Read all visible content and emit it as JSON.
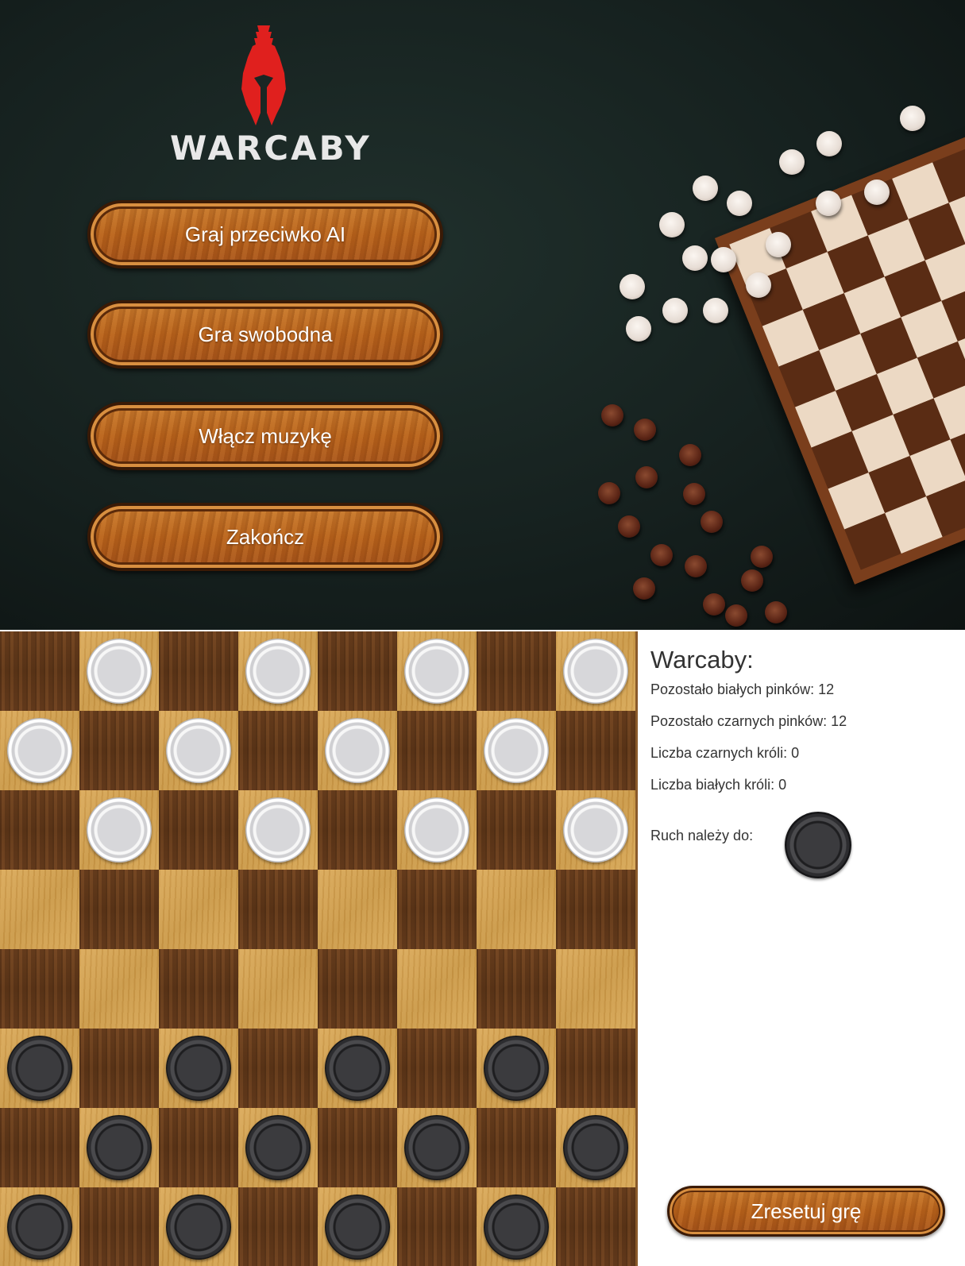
{
  "menu": {
    "logo_text": "WARCABY",
    "buttons": [
      {
        "label": "Graj przeciwko AI"
      },
      {
        "label": "Gra swobodna"
      },
      {
        "label": "Włącz muzykę"
      },
      {
        "label": "Zakończ"
      }
    ]
  },
  "board": {
    "rows": [
      [
        "",
        "w",
        "",
        "w",
        "",
        "w",
        "",
        "w"
      ],
      [
        "w",
        "",
        "w",
        "",
        "w",
        "",
        "w",
        ""
      ],
      [
        "",
        "w",
        "",
        "w",
        "",
        "w",
        "",
        "w"
      ],
      [
        "",
        "",
        "",
        "",
        "",
        "",
        "",
        ""
      ],
      [
        "",
        "",
        "",
        "",
        "",
        "",
        "",
        ""
      ],
      [
        "b",
        "",
        "b",
        "",
        "b",
        "",
        "b",
        ""
      ],
      [
        "",
        "b",
        "",
        "b",
        "",
        "b",
        "",
        "b"
      ],
      [
        "b",
        "",
        "b",
        "",
        "b",
        "",
        "b",
        ""
      ]
    ]
  },
  "panel": {
    "title": "Warcaby:",
    "white_left": "Pozostało białych pinków: 12",
    "black_left": "Pozostało czarnych pinków: 12",
    "black_kings": "Liczba czarnych króli: 0",
    "white_kings": "Liczba białych króli: 0",
    "turn_label": "Ruch należy do:",
    "turn_piece": "black-piece-icon",
    "reset_label": "Zresetuj grę"
  },
  "colors": {
    "accent_wood": "#b8621b",
    "logo_red": "#e0201e"
  }
}
